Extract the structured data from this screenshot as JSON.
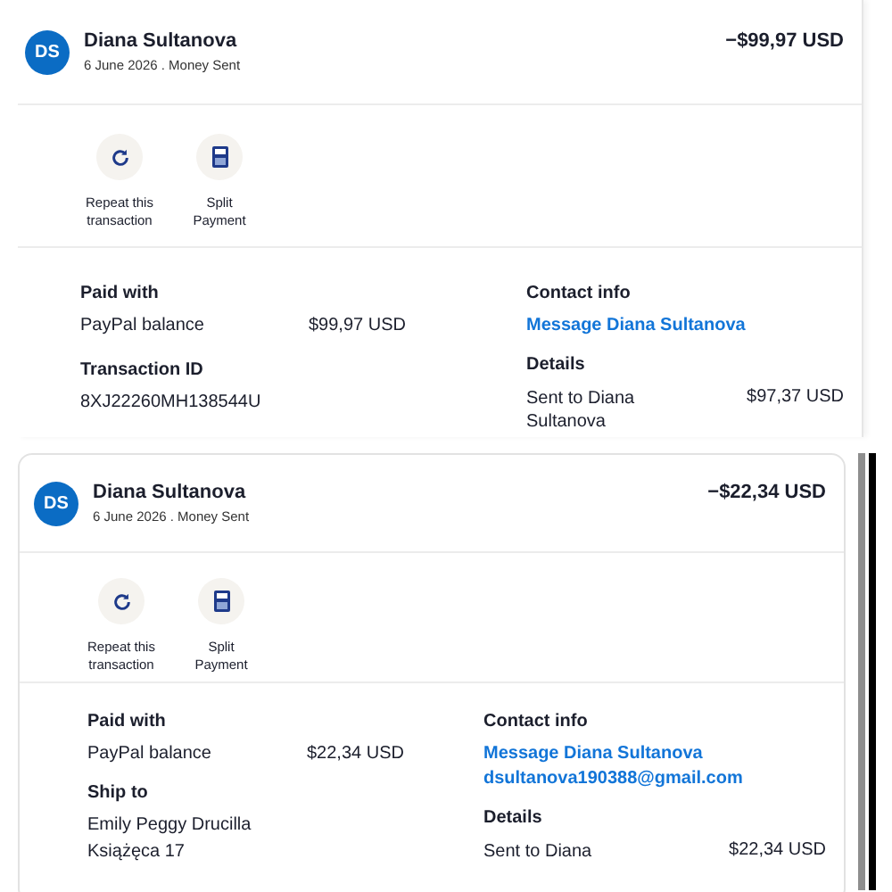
{
  "transactions": [
    {
      "initials": "DS",
      "name": "Diana Sultanova",
      "subtitle": "6 June 2026 . Money Sent",
      "amount": "−$99,97 USD",
      "actions": [
        {
          "kind": "repeat",
          "label": "Repeat this transaction"
        },
        {
          "kind": "split",
          "label": "Split Payment"
        }
      ],
      "paid_with": {
        "heading": "Paid with",
        "method": "PayPal balance",
        "amount": "$99,97 USD"
      },
      "info": {
        "heading": "Transaction ID",
        "lines": [
          "8XJ22260MH138544U"
        ]
      },
      "contact": {
        "heading": "Contact info",
        "links": [
          "Message Diana Sultanova"
        ]
      },
      "details": {
        "heading": "Details",
        "description": "Sent to Diana Sultanova",
        "amount": "$97,37 USD"
      }
    },
    {
      "initials": "DS",
      "name": "Diana Sultanova",
      "subtitle": "6 June 2026 . Money Sent",
      "amount": "−$22,34 USD",
      "actions": [
        {
          "kind": "repeat",
          "label": "Repeat this transaction"
        },
        {
          "kind": "split",
          "label": "Split Payment"
        }
      ],
      "paid_with": {
        "heading": "Paid with",
        "method": "PayPal balance",
        "amount": "$22,34 USD"
      },
      "info": {
        "heading": "Ship to",
        "lines": [
          "Emily Peggy Drucilla",
          "Książęca 17"
        ]
      },
      "contact": {
        "heading": "Contact info",
        "links": [
          "Message Diana Sultanova",
          "dsultanova190388@gmail.com"
        ]
      },
      "details": {
        "heading": "Details",
        "description": "Sent to Diana",
        "amount": "$22,34 USD"
      }
    }
  ]
}
